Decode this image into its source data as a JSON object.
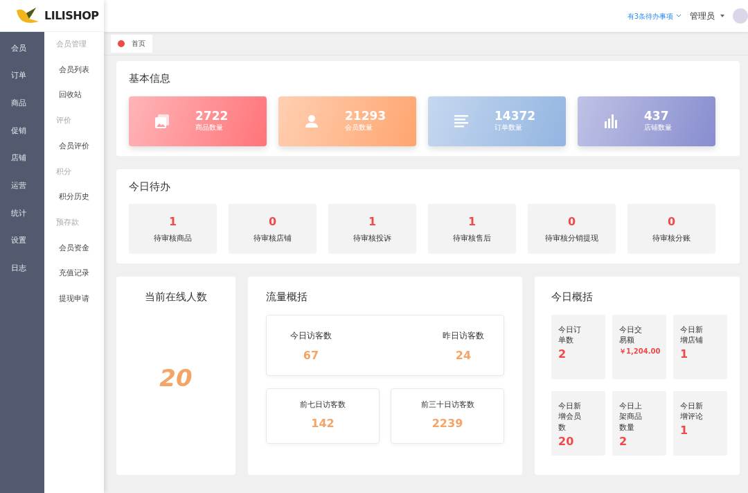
{
  "logo": {
    "text": "LILISHOP"
  },
  "header": {
    "todo_link": "有3条待办事项",
    "user": "管理员"
  },
  "main_nav": [
    {
      "label": "会员"
    },
    {
      "label": "订单"
    },
    {
      "label": "商品"
    },
    {
      "label": "促销"
    },
    {
      "label": "店铺"
    },
    {
      "label": "运营"
    },
    {
      "label": "统计"
    },
    {
      "label": "设置"
    },
    {
      "label": "日志"
    }
  ],
  "sub_nav": [
    {
      "kind": "group",
      "label": "会员管理"
    },
    {
      "kind": "item",
      "label": "会员列表"
    },
    {
      "kind": "item",
      "label": "回收站"
    },
    {
      "kind": "group",
      "label": "评价"
    },
    {
      "kind": "item",
      "label": "会员评价"
    },
    {
      "kind": "group",
      "label": "积分"
    },
    {
      "kind": "item",
      "label": "积分历史"
    },
    {
      "kind": "group",
      "label": "预存款"
    },
    {
      "kind": "item",
      "label": "会员资金"
    },
    {
      "kind": "item",
      "label": "充值记录"
    },
    {
      "kind": "item",
      "label": "提现申请"
    }
  ],
  "tabs": [
    {
      "label": "首页",
      "selected": true
    }
  ],
  "basic_info": {
    "title": "基本信息",
    "stats": [
      {
        "value": "2722",
        "label": "商品数量",
        "color": "#ff7479"
      },
      {
        "value": "21293",
        "label": "会员数量",
        "color": "#ffa56f"
      },
      {
        "value": "14372",
        "label": "订单数量",
        "color": "#93b5e1"
      },
      {
        "value": "437",
        "label": "店铺数量",
        "color": "#878dcf"
      }
    ]
  },
  "todo": {
    "title": "今日待办",
    "items": [
      {
        "value": "1",
        "label": "待审核商品"
      },
      {
        "value": "0",
        "label": "待审核店铺"
      },
      {
        "value": "1",
        "label": "待审核投诉"
      },
      {
        "value": "1",
        "label": "待审核售后"
      },
      {
        "value": "0",
        "label": "待审核分销提现"
      },
      {
        "value": "0",
        "label": "待审核分账"
      }
    ]
  },
  "online": {
    "title": "当前在线人数",
    "value": "20"
  },
  "traffic": {
    "title": "流量概括",
    "top": [
      {
        "label": "今日访客数",
        "value": "67"
      },
      {
        "label": "昨日访客数",
        "value": "24"
      }
    ],
    "bottom": [
      {
        "label": "前七日访客数",
        "value": "142"
      },
      {
        "label": "前三十日访客数",
        "value": "2239"
      }
    ]
  },
  "overview": {
    "title": "今日概括",
    "items": [
      {
        "label": "今日订单数",
        "value": "2"
      },
      {
        "label": "今日交易额",
        "value": "￥1,204.00"
      },
      {
        "label": "今日新增店铺",
        "value": "1"
      },
      {
        "label": "今日新增会员数",
        "value": "20"
      },
      {
        "label": "今日上架商品数量",
        "value": "2"
      },
      {
        "label": "今日新增评论",
        "value": "1"
      }
    ]
  }
}
